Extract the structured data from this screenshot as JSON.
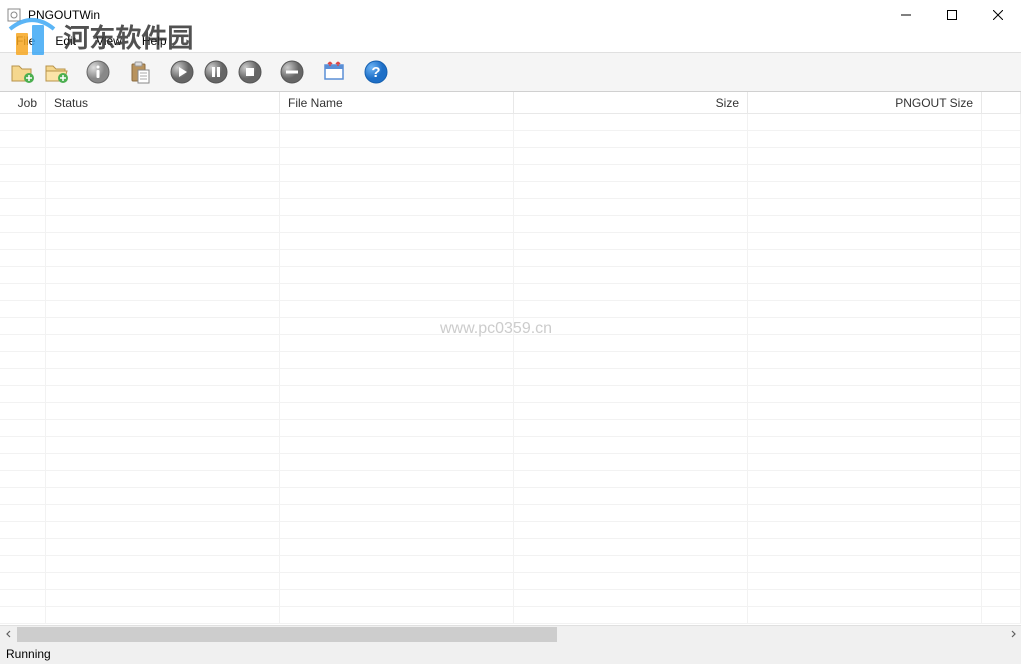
{
  "window": {
    "title": "PNGOUTWin"
  },
  "menu": {
    "file": "File",
    "edit": "Edit",
    "view": "View",
    "help": "Help"
  },
  "toolbar": {
    "add_file": "add-file",
    "add_folder": "add-folder",
    "info": "info",
    "paste": "paste",
    "play": "play",
    "pause": "pause",
    "stop": "stop",
    "remove": "remove",
    "columns": "columns",
    "help": "help"
  },
  "columns": {
    "job": "Job",
    "status": "Status",
    "filename": "File Name",
    "size": "Size",
    "pngout_size": "PNGOUT Size"
  },
  "column_widths": {
    "job": 46,
    "status": 234,
    "filename": 234,
    "size": 234,
    "pngout_size": 234
  },
  "rows": [],
  "status": {
    "text": "Running"
  },
  "watermark": {
    "text": "河东软件园",
    "url": "www.pc0359.cn"
  }
}
